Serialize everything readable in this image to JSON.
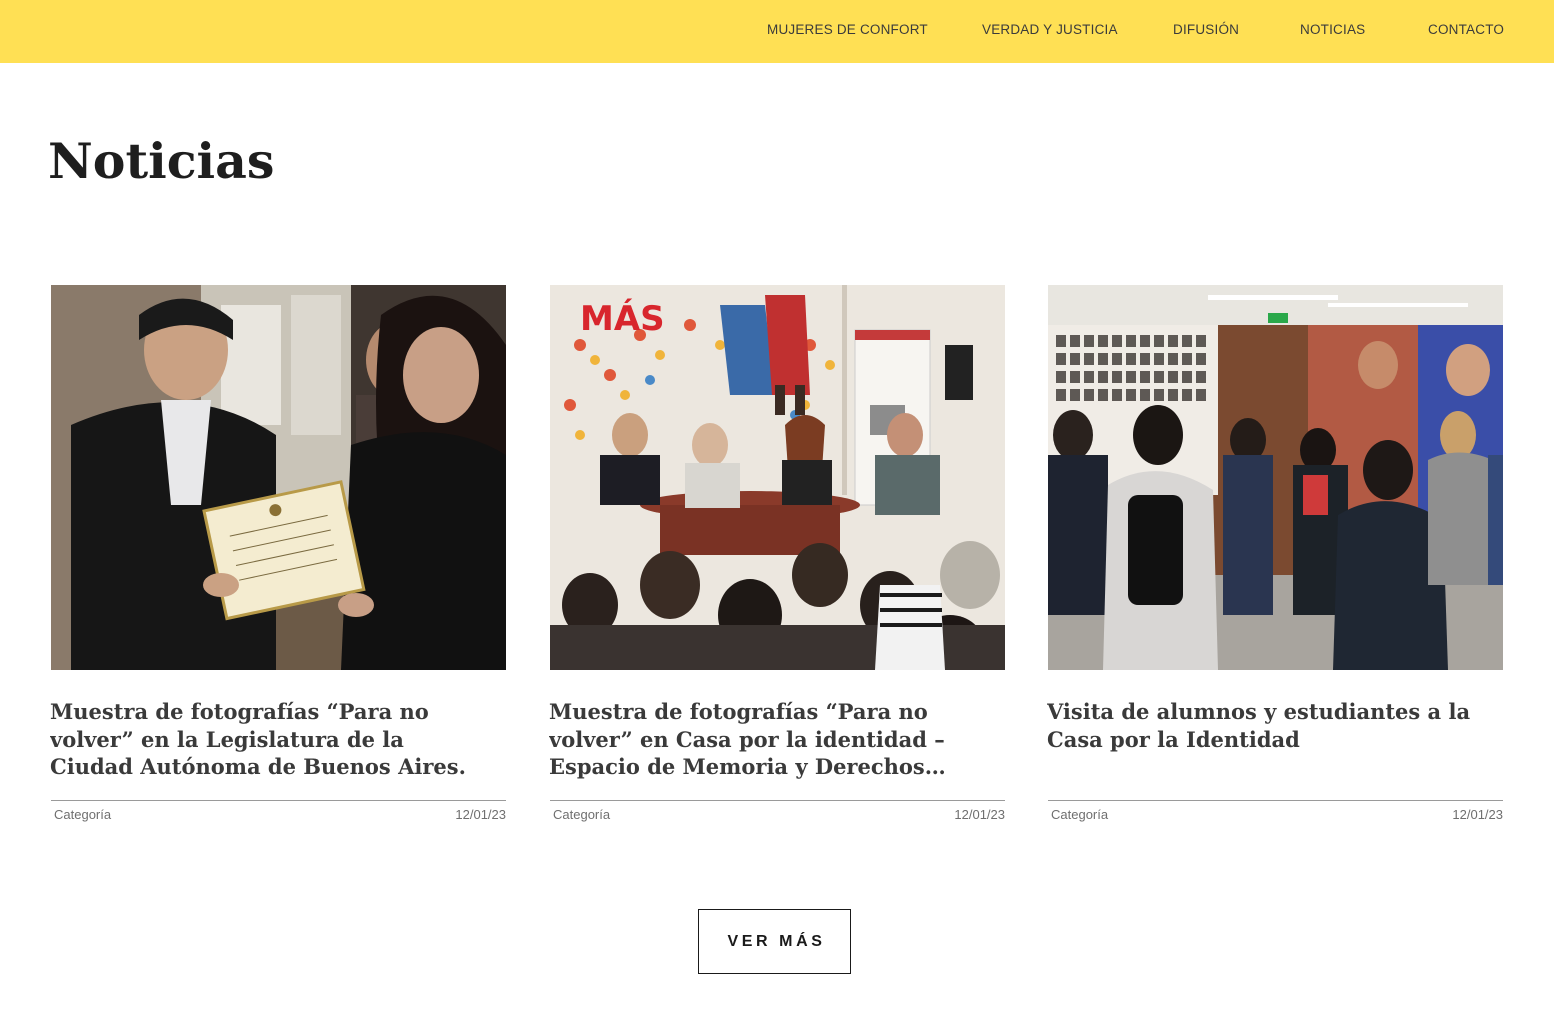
{
  "nav": {
    "items": [
      {
        "label": "MUJERES DE CONFORT"
      },
      {
        "label": "VERDAD Y JUSTICIA"
      },
      {
        "label": "DIFUSIÓN"
      },
      {
        "label": "NOTICIAS"
      },
      {
        "label": "CONTACTO"
      }
    ]
  },
  "page": {
    "title": "Noticias"
  },
  "news": [
    {
      "title": "Muestra de fotografías “Para no volver” en la Legislatura de la Ciudad Autónoma de Buenos Aires.",
      "category": "Categoría",
      "date": "12/01/23"
    },
    {
      "title": "Muestra de fotografías “Para no volver” en Casa por la identidad – Espacio de Memoria y Derechos…",
      "category": "Categoría",
      "date": "12/01/23"
    },
    {
      "title": "Visita de  alumnos y estudiantes  a la Casa por la Identidad",
      "category": "Categoría",
      "date": "12/01/23"
    }
  ],
  "more_button": {
    "label": "VER MÁS"
  },
  "colors": {
    "header_bg": "#ffe054",
    "title": "#1e1e1e",
    "text": "#3a3a3a",
    "meta": "#6f6f6f"
  }
}
